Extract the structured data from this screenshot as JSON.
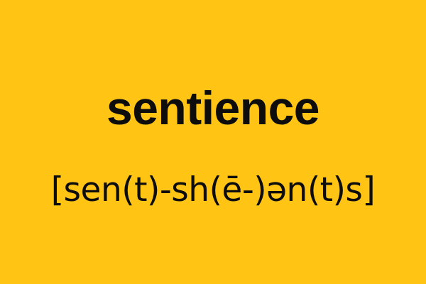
{
  "card": {
    "word": "sentience",
    "pronunciation": "[sen(t)-sh(ē-)ən(t)s]",
    "colors": {
      "background": "#FFC414",
      "text": "#0D0D0D"
    }
  }
}
